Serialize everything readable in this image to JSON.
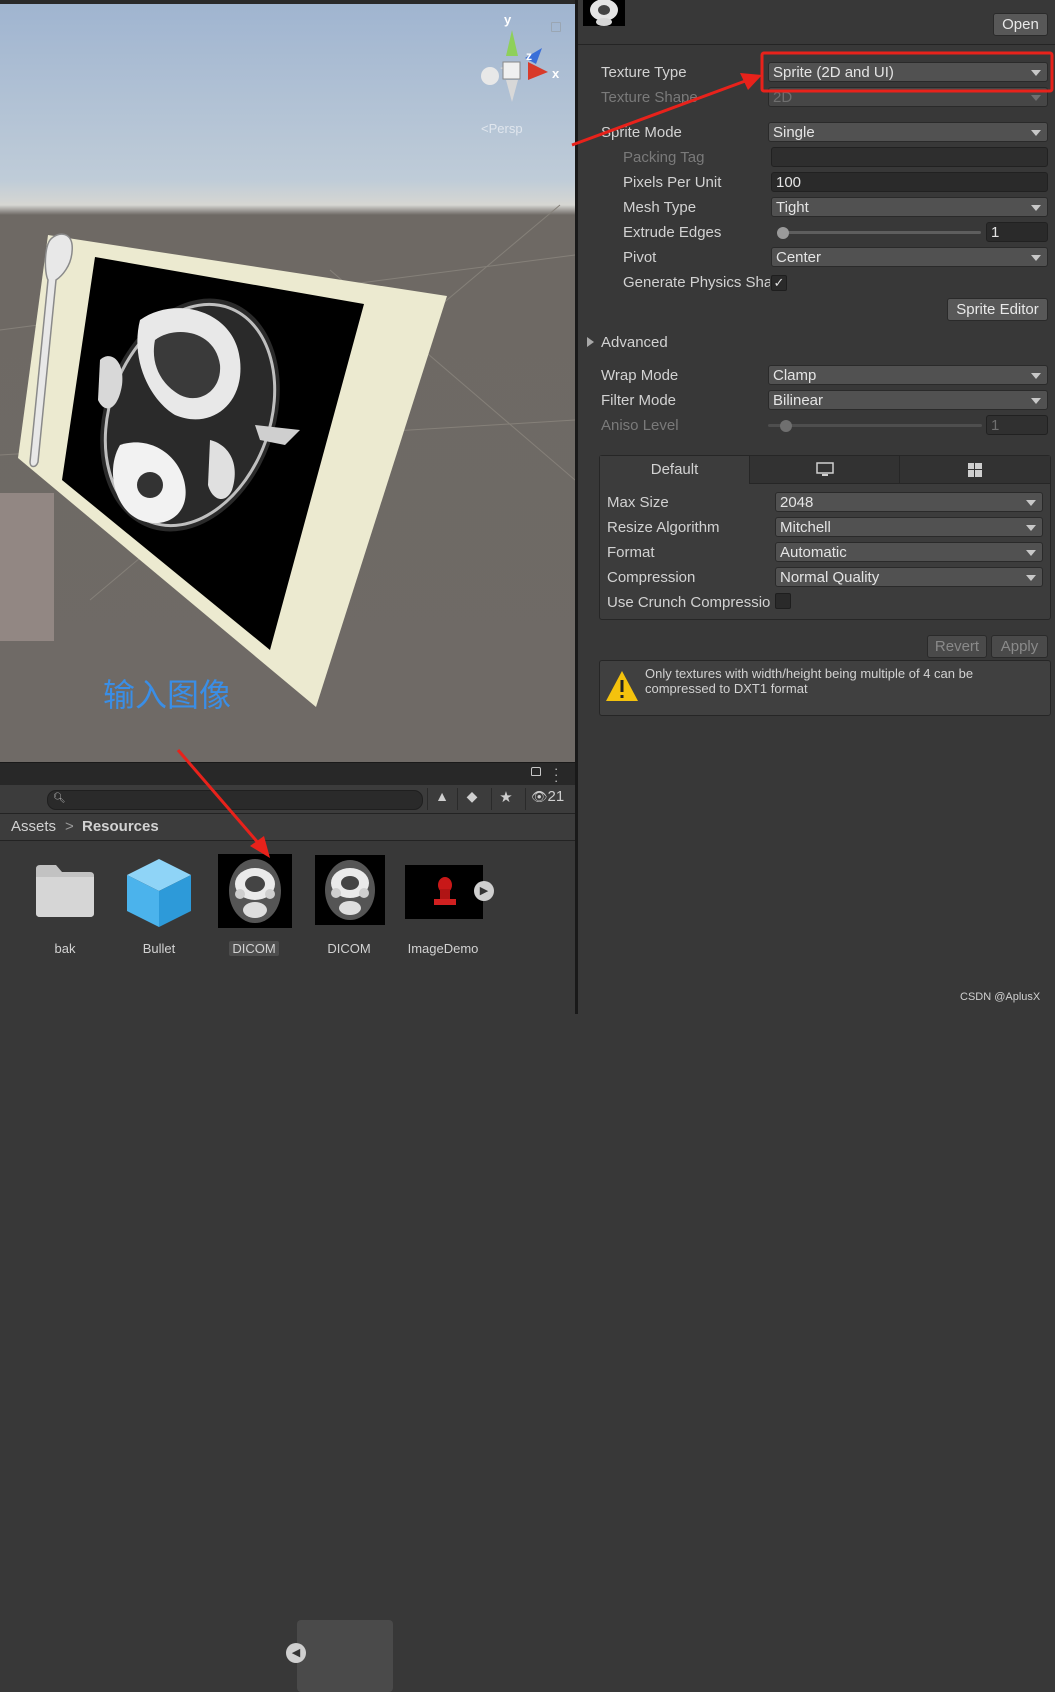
{
  "scene": {
    "axis_y": "y",
    "axis_z": "z",
    "axis_x": "x",
    "projection_label": "Persp",
    "annotation_text": "输入图像"
  },
  "project": {
    "search": {
      "value": "",
      "placeholder": ""
    },
    "hidden_count": "21",
    "breadcrumb": {
      "root": "Assets",
      "separator": ">",
      "current": "Resources"
    },
    "assets": [
      {
        "label": "bak",
        "icon": "folder-icon"
      },
      {
        "label": "Bullet",
        "icon": "cube-prefab-icon"
      },
      {
        "label": "DICOM",
        "icon": "texture-thumbnail",
        "selected": true
      },
      {
        "label": "DICOM",
        "icon": "sprite-thumbnail"
      },
      {
        "label": "ImageDemo",
        "icon": "image-thumbnail"
      }
    ]
  },
  "inspector": {
    "open_button": "Open",
    "texture_type": {
      "label": "Texture Type",
      "value": "Sprite (2D and UI)"
    },
    "texture_shape": {
      "label": "Texture Shape",
      "value": "2D"
    },
    "sprite_mode": {
      "label": "Sprite Mode",
      "value": "Single"
    },
    "packing_tag": {
      "label": "Packing Tag",
      "value": ""
    },
    "pixels_per_unit": {
      "label": "Pixels Per Unit",
      "value": "100"
    },
    "mesh_type": {
      "label": "Mesh Type",
      "value": "Tight"
    },
    "extrude_edges": {
      "label": "Extrude Edges",
      "value": "1"
    },
    "pivot": {
      "label": "Pivot",
      "value": "Center"
    },
    "generate_physics": {
      "label": "Generate Physics Shape",
      "checked": true
    },
    "sprite_editor_button": "Sprite Editor",
    "advanced": "Advanced",
    "wrap_mode": {
      "label": "Wrap Mode",
      "value": "Clamp"
    },
    "filter_mode": {
      "label": "Filter Mode",
      "value": "Bilinear"
    },
    "aniso_level": {
      "label": "Aniso Level",
      "value": "1"
    },
    "platform_tabs": {
      "default": "Default",
      "standalone_icon": "monitor-icon",
      "windows_icon": "windows-icon"
    },
    "max_size": {
      "label": "Max Size",
      "value": "2048"
    },
    "resize_algorithm": {
      "label": "Resize Algorithm",
      "value": "Mitchell"
    },
    "format": {
      "label": "Format",
      "value": "Automatic"
    },
    "compression": {
      "label": "Compression",
      "value": "Normal Quality"
    },
    "crunch": {
      "label": "Use Crunch Compression",
      "checked": false
    },
    "revert_button": "Revert",
    "apply_button": "Apply",
    "warning_text": "Only textures with width/height being multiple of 4 can be compressed to DXT1 format"
  },
  "watermark": "CSDN @AplusX",
  "colors": {
    "highlight_red": "#e8221b",
    "annotation_blue": "#3a8ee6",
    "panel_bg": "#383838"
  }
}
